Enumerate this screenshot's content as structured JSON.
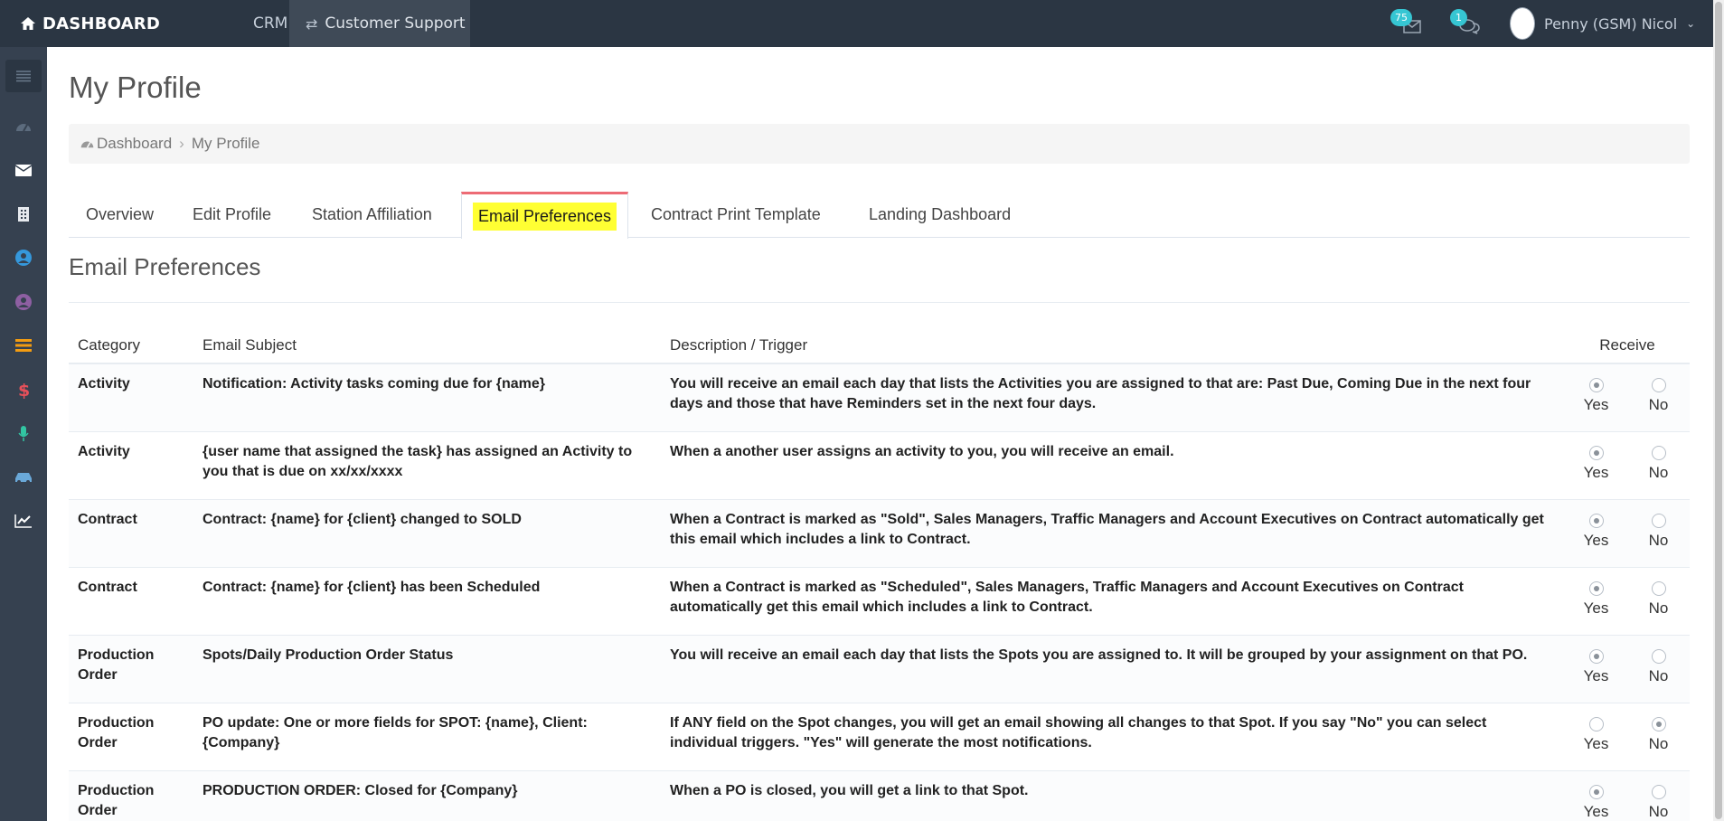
{
  "topbar": {
    "brand": "DASHBOARD",
    "crm_label": "CRM",
    "support_label": "Customer Support",
    "email_count": "75",
    "chat_count": "1",
    "user_name": "Penny (GSM) Nicol"
  },
  "page": {
    "title": "My Profile",
    "breadcrumb": [
      "Dashboard",
      "My Profile"
    ]
  },
  "tabs": [
    "Overview",
    "Edit Profile",
    "Station Affiliation",
    "Email Preferences",
    "Contract Print Template",
    "Landing Dashboard"
  ],
  "section_title": "Email Preferences",
  "table": {
    "headers": {
      "category": "Category",
      "subject": "Email Subject",
      "description": "Description / Trigger",
      "receive": "Receive"
    },
    "yes_label": "Yes",
    "no_label": "No",
    "rows": [
      {
        "category": "Activity",
        "subject": "Notification: Activity tasks coming due for {name}",
        "description": "You will receive an email each day that lists the Activities you are assigned to that are: Past Due, Coming Due in the next four days and those that have Reminders set in the next four days.",
        "receive": "Yes"
      },
      {
        "category": "Activity",
        "subject": "{user name that assigned the task} has assigned an Activity to you that is due on xx/xx/xxxx",
        "description": "When a another user assigns an activity to you, you will receive an email.",
        "receive": "Yes"
      },
      {
        "category": "Contract",
        "subject": "Contract: {name} for {client} changed to SOLD",
        "description": "When a Contract is marked as \"Sold\", Sales Managers, Traffic Managers and Account Executives on Contract automatically get this email which includes a link to Contract.",
        "receive": "Yes"
      },
      {
        "category": "Contract",
        "subject": "Contract: {name} for {client} has been Scheduled",
        "description": "When a Contract is marked as \"Scheduled\", Sales Managers, Traffic Managers and Account Executives on Contract automatically get this email which includes a link to Contract.",
        "receive": "Yes"
      },
      {
        "category": "Production Order",
        "subject": "Spots/Daily Production Order Status",
        "description": "You will receive an email each day that lists the Spots you are assigned to. It will be grouped by your assignment on that PO.",
        "receive": "Yes"
      },
      {
        "category": "Production Order",
        "subject": "PO update: One or more fields for SPOT: {name}, Client: {Company}",
        "description": "If ANY field on the Spot changes, you will get an email showing all changes to that Spot. If you say \"No\" you can select individual triggers. \"Yes\" will generate the most notifications.",
        "receive": "No"
      },
      {
        "category": "Production Order",
        "subject": "PRODUCTION ORDER: Closed for {Company}",
        "description": "When a PO is closed, you will get a link to that Spot.",
        "receive": "Yes"
      }
    ]
  },
  "colors": {
    "navbar": "#2b3643",
    "sidebar": "#364150",
    "active_tab_accent": "#ed6b75",
    "highlight": "#ffff33",
    "badge": "#36c6d3"
  }
}
